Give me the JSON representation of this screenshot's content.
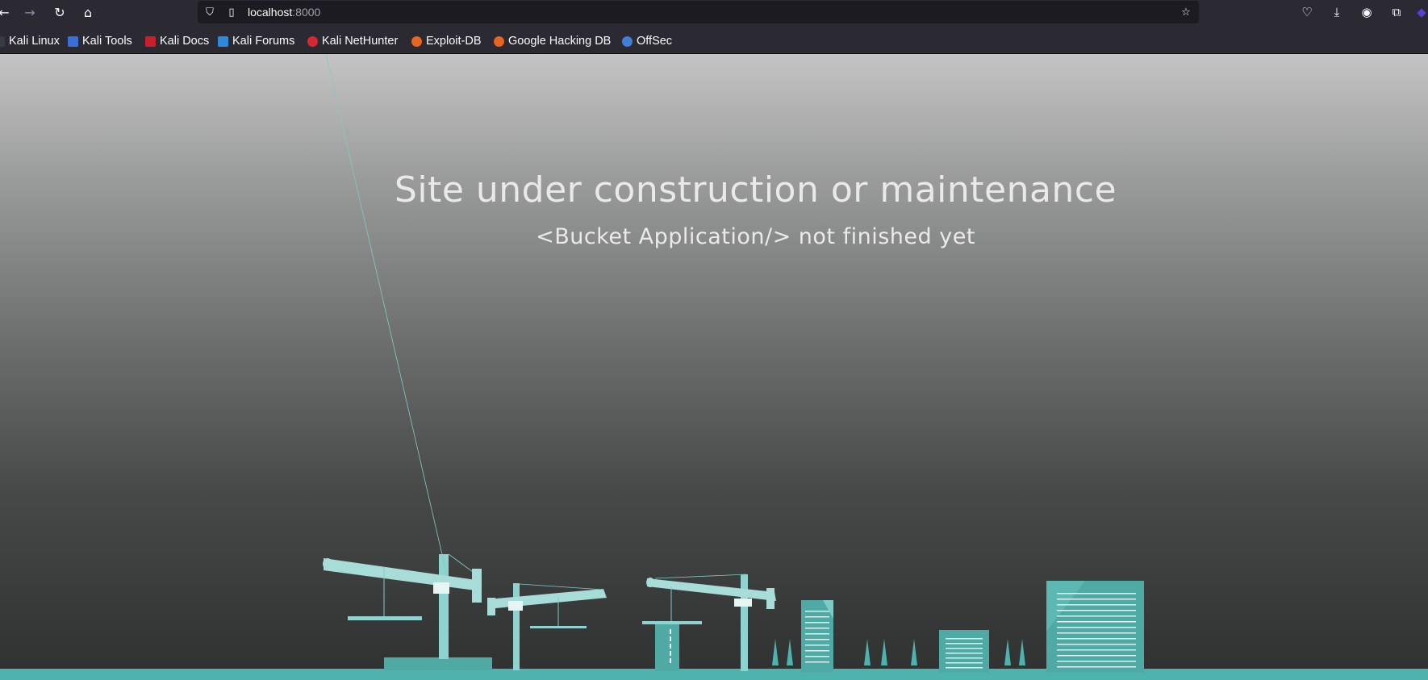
{
  "browser": {
    "url_host": "localhost",
    "url_port": ":8000",
    "nav_icons": [
      "back-arrow-icon",
      "forward-arrow-icon",
      "reload-icon",
      "home-icon"
    ],
    "right_icons": [
      "pocket-icon",
      "download-icon",
      "account-icon",
      "extensions-icon"
    ]
  },
  "bookmarks": [
    {
      "label": "Kali Linux",
      "icon": "kali-dragon-icon"
    },
    {
      "label": "Kali Tools",
      "icon": "kali-tools-icon"
    },
    {
      "label": "Kali Docs",
      "icon": "kali-docs-icon"
    },
    {
      "label": "Kali Forums",
      "icon": "kali-forums-icon"
    },
    {
      "label": "Kali NetHunter",
      "icon": "nethunter-icon"
    },
    {
      "label": "Exploit-DB",
      "icon": "exploitdb-icon"
    },
    {
      "label": "Google Hacking DB",
      "icon": "ghdb-icon"
    },
    {
      "label": "OffSec",
      "icon": "offsec-icon"
    }
  ],
  "page": {
    "headline": "Site under construction or maintenance",
    "subline": "<Bucket Application/> not finished yet"
  },
  "colors": {
    "accent_teal": "#7ecbc7",
    "teal_dark": "#4fa9a4",
    "ground": "#4fb3ad",
    "gradient_top": "#c4c4c4",
    "gradient_bottom": "#2f3131"
  }
}
